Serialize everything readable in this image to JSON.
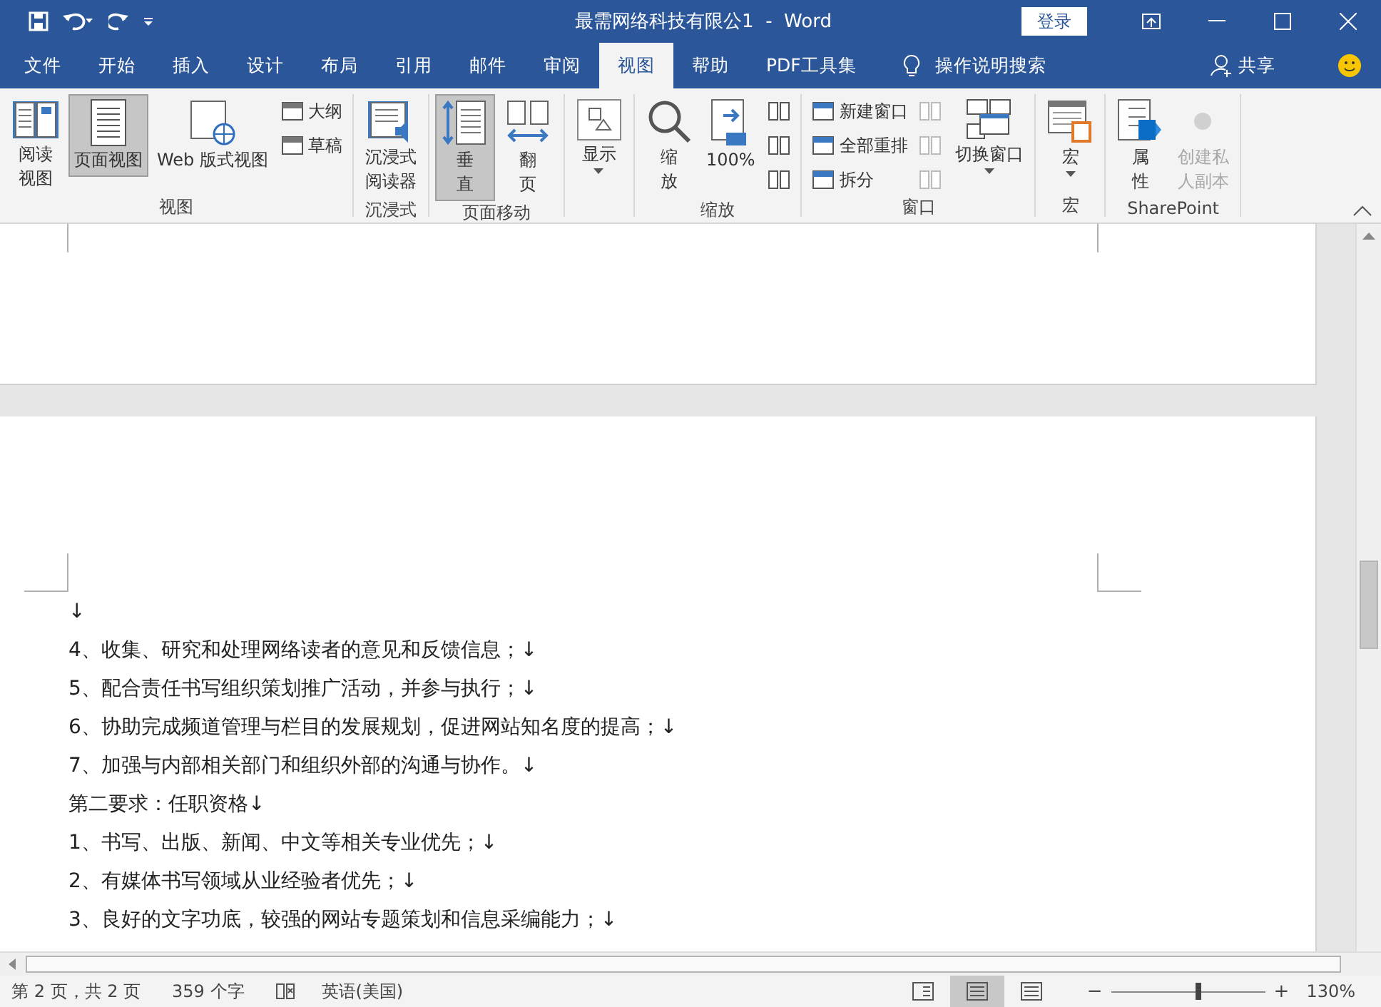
{
  "title_bar": {
    "title": "最需网络科技有限公1  -  Word",
    "sign_in": "登录"
  },
  "tabs": [
    {
      "label": "文件",
      "selected": false
    },
    {
      "label": "开始",
      "selected": false
    },
    {
      "label": "插入",
      "selected": false
    },
    {
      "label": "设计",
      "selected": false
    },
    {
      "label": "布局",
      "selected": false
    },
    {
      "label": "引用",
      "selected": false
    },
    {
      "label": "邮件",
      "selected": false
    },
    {
      "label": "审阅",
      "selected": false
    },
    {
      "label": "视图",
      "selected": true
    },
    {
      "label": "帮助",
      "selected": false
    },
    {
      "label": "PDF工具集",
      "selected": false
    }
  ],
  "tell_me": "操作说明搜索",
  "share": "共享",
  "ribbon": [
    {
      "label": "视图",
      "items": [
        {
          "kind": "large",
          "lines": [
            "阅读",
            "视图"
          ],
          "selected": false,
          "disabled": false
        },
        {
          "kind": "large",
          "lines": [
            "页面视图"
          ],
          "selected": true,
          "disabled": false
        },
        {
          "kind": "large",
          "lines": [
            "Web 版式视图"
          ],
          "selected": false,
          "disabled": false
        },
        {
          "kind": "small",
          "labels": [
            "大纲",
            "草稿"
          ]
        }
      ]
    },
    {
      "label": "沉浸式",
      "items": [
        {
          "kind": "large",
          "lines": [
            "沉浸式",
            "阅读器"
          ],
          "selected": false,
          "disabled": false
        }
      ]
    },
    {
      "label": "页面移动",
      "items": [
        {
          "kind": "large",
          "lines": [
            "垂",
            "直"
          ],
          "selected": true,
          "disabled": false
        },
        {
          "kind": "large",
          "lines": [
            "翻",
            "页"
          ],
          "selected": false,
          "disabled": false
        }
      ]
    },
    {
      "items": [
        {
          "kind": "dropdown",
          "lines": [
            "显示"
          ],
          "selected": false,
          "disabled": false
        }
      ]
    },
    {
      "label": "缩放",
      "items": [
        {
          "kind": "large",
          "lines": [
            "缩",
            "放"
          ],
          "selected": false,
          "disabled": false
        },
        {
          "kind": "large",
          "lines": [
            "100%"
          ],
          "selected": false,
          "disabled": false
        },
        {
          "kind": "icons",
          "disabled": false
        }
      ]
    },
    {
      "label": "窗口",
      "items": [
        {
          "kind": "small",
          "labels": [
            "新建窗口",
            "全部重排",
            "拆分"
          ]
        },
        {
          "kind": "icons",
          "disabled": true
        },
        {
          "kind": "dropdown",
          "lines": [
            "切换窗口"
          ],
          "selected": false,
          "disabled": false
        }
      ]
    },
    {
      "label": "宏",
      "items": [
        {
          "kind": "dropdown",
          "lines": [
            "宏"
          ],
          "selected": false,
          "disabled": false
        }
      ]
    },
    {
      "label": "SharePoint",
      "items": [
        {
          "kind": "large",
          "lines": [
            "属",
            "性"
          ],
          "selected": false,
          "disabled": false
        },
        {
          "kind": "large",
          "lines": [
            "创建私",
            "人副本"
          ],
          "selected": false,
          "disabled": true
        }
      ]
    }
  ],
  "document": {
    "paragraphs": [
      "↓",
      "4、收集、研究和处理网络读者的意见和反馈信息；↓",
      "5、配合责任书写组织策划推广活动，并参与执行；↓",
      "6、协助完成频道管理与栏目的发展规划，促进网站知名度的提高；↓",
      "7、加强与内部相关部门和组织外部的沟通与协作。↓",
      "第二要求：任职资格↓",
      "1、书写、出版、新闻、中文等相关专业优先；↓",
      "2、有媒体书写领域从业经验者优先；↓",
      "3、良好的文字功底，较强的网站专题策划和信息采编能力；↓"
    ]
  },
  "status_bar": {
    "page": "第 2 页，共 2 页",
    "words": "359 个字",
    "language": "英语(美国)",
    "views": [
      {
        "selected": false
      },
      {
        "selected": true
      },
      {
        "selected": false
      }
    ],
    "zoom_minus": "−",
    "zoom_plus": "+",
    "zoom": {
      "level": 0.57
    },
    "zoom_reading": "130%"
  }
}
